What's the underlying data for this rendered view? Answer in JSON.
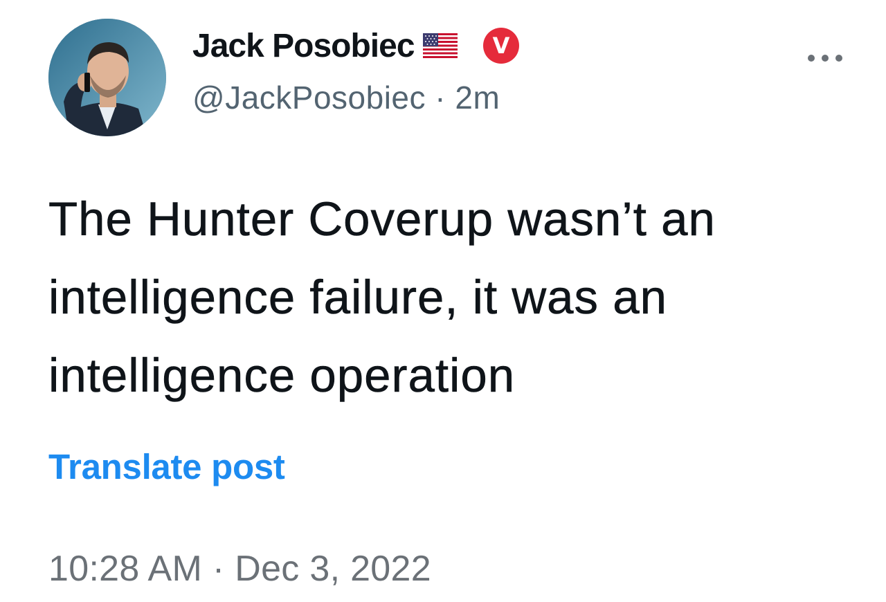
{
  "author": {
    "display_name": "Jack Posobiec",
    "flag_emoji": "🇺🇸",
    "handle": "@JackPosobiec",
    "relative_time": "2m",
    "separator": "·",
    "badge_letter": "V",
    "badge_color": "#e52b3b"
  },
  "post": {
    "text": "The Hunter Coverup wasn’t an intelligence failure, it was an intelligence operation"
  },
  "actions": {
    "translate_label": "Translate post",
    "more_icon": "more-horizontal-icon"
  },
  "meta": {
    "time": "10:28 AM",
    "separator": "·",
    "date": "Dec 3, 2022"
  },
  "colors": {
    "text_primary": "#0f1419",
    "text_secondary": "#536471",
    "link": "#1d8bf0"
  }
}
